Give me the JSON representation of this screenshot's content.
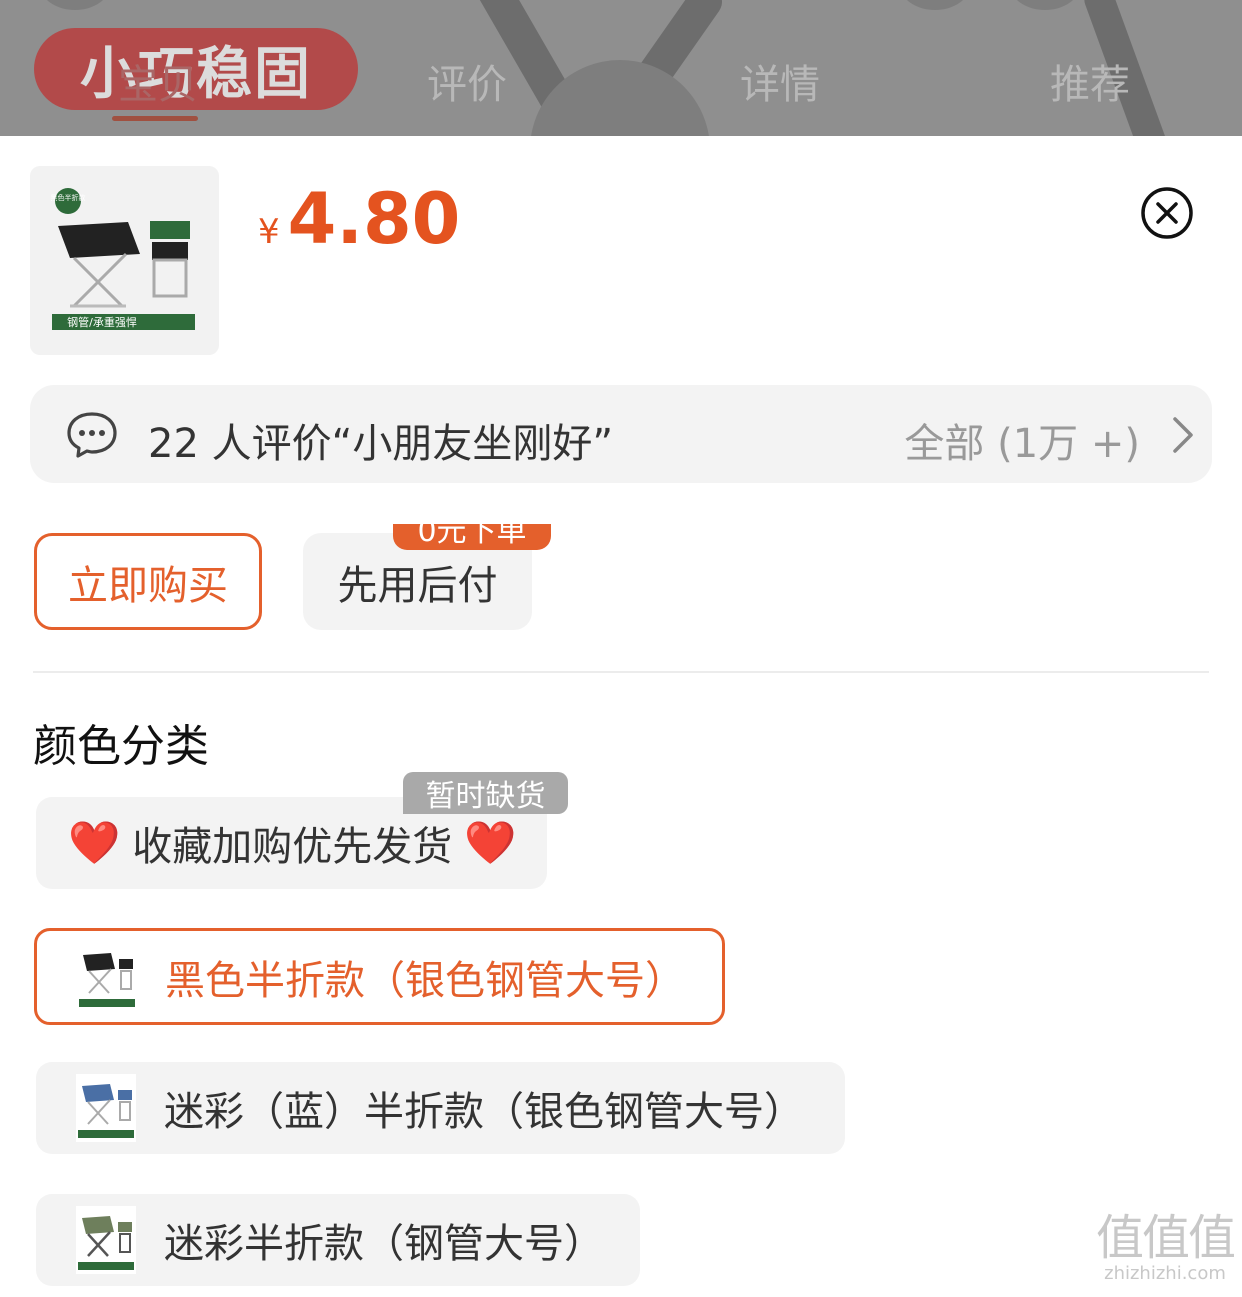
{
  "nav": {
    "brand": "小巧稳固",
    "tabs": [
      "宝贝",
      "评价",
      "详情",
      "推荐"
    ]
  },
  "product": {
    "thumb_badge": "黑色半折款",
    "thumb_caption": "钢管/承重强悍",
    "currency": "¥",
    "price": "4.80"
  },
  "reviews": {
    "summary": "22 人评价“小朋友坐刚好”",
    "all_label": "全部 (1万 +)"
  },
  "actions": {
    "buy_now": "立即购买",
    "pay_later": "先用后付",
    "pay_later_badge": "0元下单"
  },
  "sku_section": {
    "title": "颜色分类",
    "options": [
      {
        "heart_left": "❤️",
        "label": "收藏加购优先发货",
        "heart_right": "❤️",
        "badge": "暂时缺货",
        "state": "out-of-stock"
      },
      {
        "label": "黑色半折款（银色钢管大号）",
        "state": "selected"
      },
      {
        "label": "迷彩（蓝）半折款（银色钢管大号）",
        "state": "normal"
      },
      {
        "label": "迷彩半折款（钢管大号）",
        "state": "normal"
      }
    ]
  },
  "watermark": {
    "glyphs": "值值值",
    "url": "zhizhizhi.com"
  },
  "colors": {
    "accent": "#e4531f",
    "surface": "#f3f3f3",
    "overlay": "#8f8f8f"
  },
  "icons": {
    "close": "close-circle-icon",
    "comment": "chat-bubble-icon",
    "chevron": "chevron-right-icon"
  }
}
